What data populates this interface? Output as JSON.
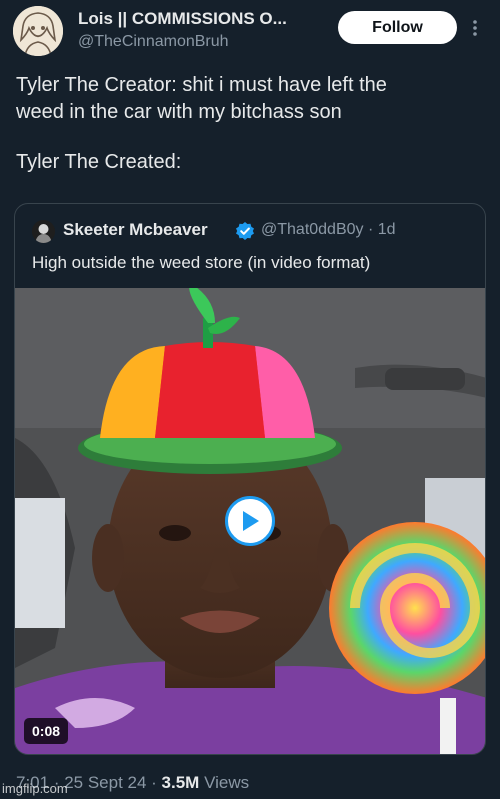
{
  "author": {
    "display_name": "Lois || COMMISSIONS O...",
    "handle": "@TheCinnamonBruh"
  },
  "follow_label": "Follow",
  "tweet": {
    "line1": "Tyler The Creator: shit i must have left the",
    "line2": "weed in the car with my bitchass son",
    "line3": "Tyler The Created:"
  },
  "quote": {
    "name": "Skeeter Mcbeaver",
    "handle_time": "@That0ddB0y · 1d",
    "text": "High outside the weed store (in video format)",
    "video_duration": "0:08"
  },
  "meta": {
    "time": "7:01",
    "date": " · 25 Sept 24 · ",
    "views_count": "3.5M",
    "views_label": " Views"
  },
  "watermark": "imgflip.com",
  "icons": [
    "more-icon",
    "verified-badge-icon",
    "play-icon"
  ],
  "colors": {
    "background": "#15202b",
    "accent": "#1d9bf0",
    "muted_text": "#8b98a5"
  }
}
